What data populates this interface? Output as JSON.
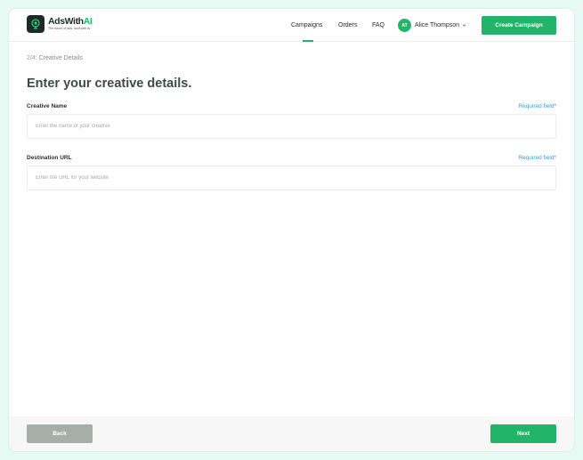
{
  "brand": {
    "name_main": "AdsWith",
    "name_accent": "AI",
    "tagline": "The future of ads, built with AI",
    "accent_color": "#22b469"
  },
  "nav": {
    "campaigns": "Campaigns",
    "orders": "Orders",
    "faq": "FAQ",
    "active": "Campaigns"
  },
  "user": {
    "initials": "AT",
    "name": "Alice Thompson",
    "menu_icon": "chevron-down-icon"
  },
  "header": {
    "create_button": "Create Campaign"
  },
  "breadcrumb": {
    "step": "2/4:",
    "label": "Creative Details"
  },
  "page": {
    "title": "Enter your creative details."
  },
  "form": {
    "creative_name": {
      "label": "Creative Name",
      "required": "Required field*",
      "placeholder": "Enter the name of your creative",
      "value": ""
    },
    "destination_url": {
      "label": "Destination URL",
      "required": "Required field*",
      "placeholder": "Enter the URL for your website",
      "value": ""
    }
  },
  "footer": {
    "back": "Back",
    "next": "Next"
  },
  "colors": {
    "primary": "#22b469",
    "required_text": "#29a3d6",
    "back_button": "#a7aeaa",
    "page_background": "#e6faf3"
  }
}
